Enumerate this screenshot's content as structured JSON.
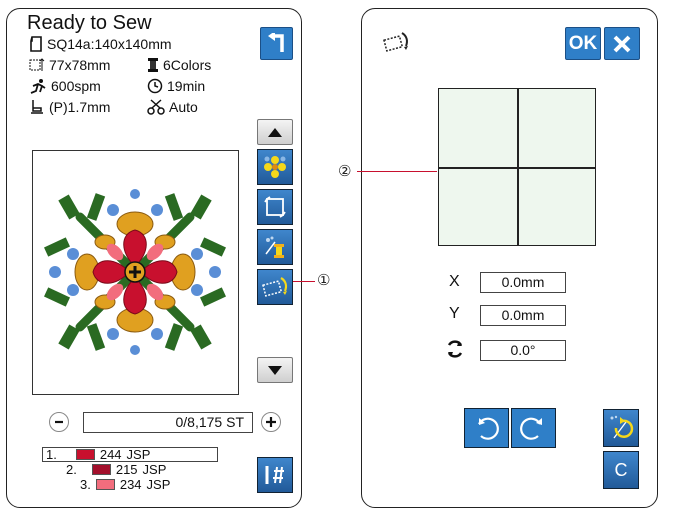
{
  "left": {
    "title": "Ready to Sew",
    "design_name": "SQ14a:140x140mm",
    "size": "77x78mm",
    "colors": "6Colors",
    "speed": "600spm",
    "time": "19min",
    "presser": "(P)1.7mm",
    "thread_cut": "Auto",
    "stitch_count": "0/8,175 ST",
    "color_list": [
      {
        "num": "1.",
        "code": "244",
        "brand": "JSP",
        "color": "#c8102e"
      },
      {
        "num": "2.",
        "code": "215",
        "brand": "JSP",
        "color": "#a3102c"
      },
      {
        "num": "3.",
        "code": "234",
        "brand": "JSP",
        "color": "#f26d7d"
      }
    ],
    "callout": "①"
  },
  "right": {
    "ok_label": "OK",
    "x_label": "X",
    "x_value": "0.0mm",
    "y_label": "Y",
    "y_value": "0.0mm",
    "angle_value": "0.0°",
    "c_label": "C",
    "callout": "②"
  },
  "colors": {
    "button_blue": "#2f7fc8",
    "grid_fill": "#eef7ee",
    "callout_line": "#c8102e"
  }
}
